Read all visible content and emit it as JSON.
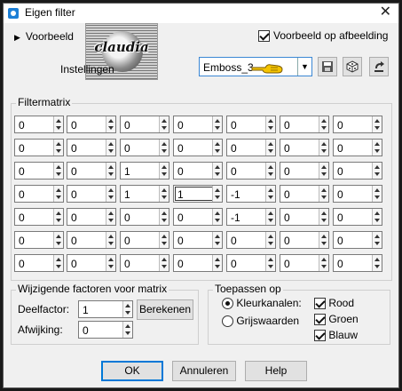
{
  "window": {
    "title": "Eigen filter"
  },
  "preview": {
    "toggle_label": "Voorbeeld",
    "on_image_label": "Voorbeeld op afbeelding",
    "on_image_checked": true,
    "watermark_text": "claudia"
  },
  "settings": {
    "label": "Instellingen",
    "preset_value": "Emboss_3"
  },
  "matrix": {
    "label": "Filtermatrix",
    "rows": [
      [
        "0",
        "0",
        "0",
        "0",
        "0",
        "0",
        "0"
      ],
      [
        "0",
        "0",
        "0",
        "0",
        "0",
        "0",
        "0"
      ],
      [
        "0",
        "0",
        "1",
        "0",
        "0",
        "0",
        "0"
      ],
      [
        "0",
        "0",
        "1",
        "1",
        "-1",
        "0",
        "0"
      ],
      [
        "0",
        "0",
        "0",
        "0",
        "-1",
        "0",
        "0"
      ],
      [
        "0",
        "0",
        "0",
        "0",
        "0",
        "0",
        "0"
      ],
      [
        "0",
        "0",
        "0",
        "0",
        "0",
        "0",
        "0"
      ]
    ]
  },
  "factors": {
    "label": "Wijzigende factoren voor matrix",
    "divisor_label": "Deelfactor:",
    "divisor_value": "1",
    "compute_button": "Berekenen",
    "bias_label": "Afwijking:",
    "bias_value": "0"
  },
  "apply": {
    "label": "Toepassen op",
    "color_channels": "Kleurkanalen:",
    "grayscale": "Grijswaarden",
    "mode_selected": "color",
    "red": "Rood",
    "green": "Groen",
    "blue": "Blauw"
  },
  "buttons": {
    "ok": "OK",
    "cancel": "Annuleren",
    "help": "Help"
  },
  "colors": {
    "accent": "#0078d7",
    "hand": "#f5c400"
  }
}
